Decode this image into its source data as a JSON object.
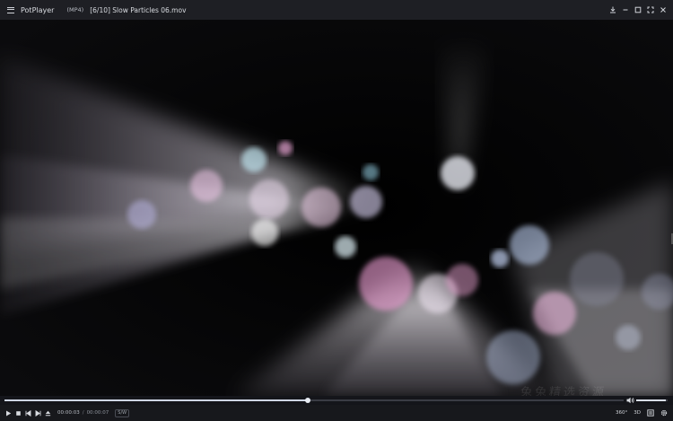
{
  "window": {
    "app_name": "PotPlayer",
    "format_badge": "(MP4)",
    "file_title": "[6/10] Slow Particles 06.mov"
  },
  "titlebar_buttons": [
    "download-icon",
    "minimize-icon",
    "maximize-icon",
    "fullscreen-icon",
    "close-icon"
  ],
  "playback": {
    "current_time": "00:00:03",
    "separator": "/",
    "duration": "00:00:07",
    "mode_badge": "S/W",
    "progress": 0.49,
    "volume": 0.95
  },
  "controls_left": [
    "play-icon",
    "stop-icon",
    "previous-icon",
    "next-icon",
    "eject-icon"
  ],
  "controls_right": {
    "vr_label": "360°",
    "three_d_label": "3D",
    "icons": [
      "playlist-icon",
      "settings-icon"
    ]
  },
  "watermark": "兔兔精选资源",
  "colors": {
    "titlebar_bg": "#1e1f24",
    "video_bg": "#000000",
    "seek_fill": "#cfd6e4",
    "text": "#cfd2d8"
  }
}
